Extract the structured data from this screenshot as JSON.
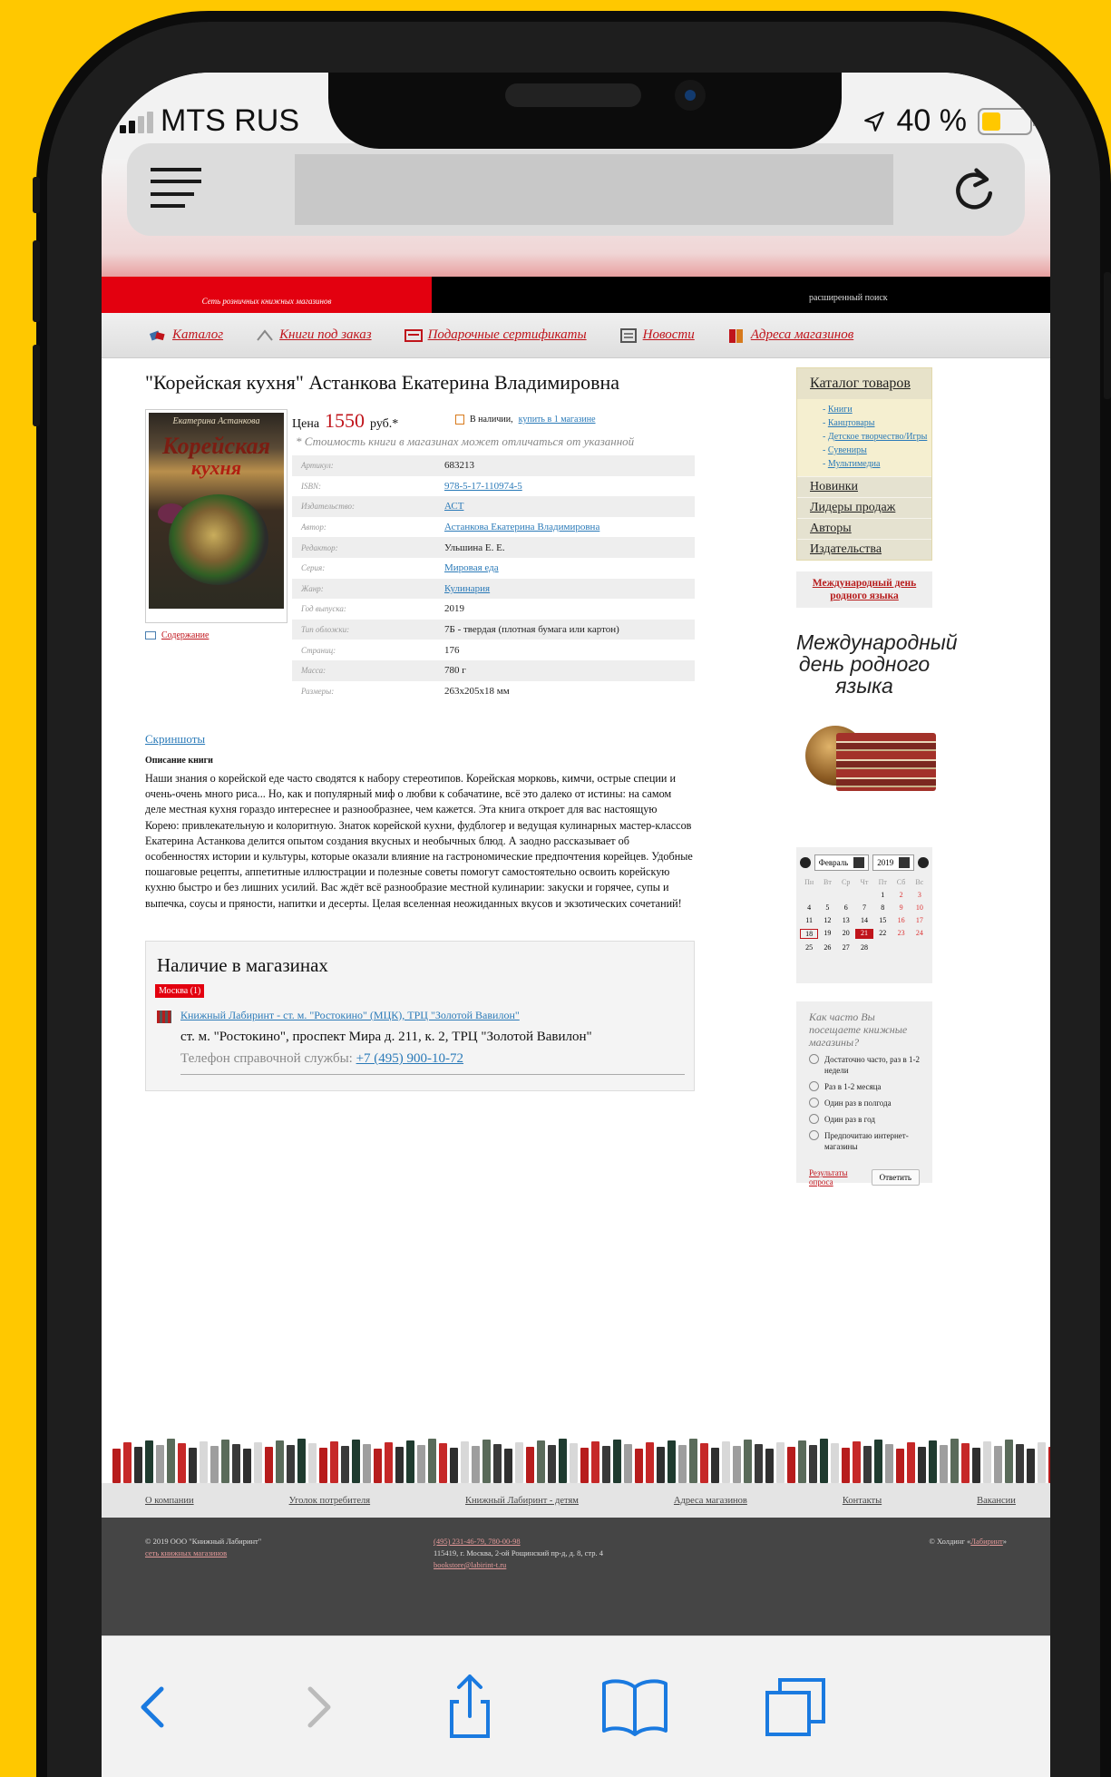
{
  "status": {
    "carrier": "MTS RUS",
    "battery": "40 %",
    "battery_level": 0.4
  },
  "header": {
    "tagline": "Сеть розничных книжных магазинов",
    "advanced_search": "расширенный поиск"
  },
  "nav": [
    {
      "label": "Каталог",
      "icon": "catalog-icon"
    },
    {
      "label": "Книги под заказ",
      "icon": "order-books-icon"
    },
    {
      "label": "Подарочные сертификаты",
      "icon": "gift-certificate-icon"
    },
    {
      "label": "Новости",
      "icon": "news-icon"
    },
    {
      "label": "Адреса магазинов",
      "icon": "store-addresses-icon"
    }
  ],
  "book": {
    "title": "\"Корейская кухня\" Астанкова Екатерина Владимировна",
    "cover_author": "Екатерина Астанкова",
    "cover_title_1": "Корейская",
    "cover_title_2": "кухня",
    "contents_link": "Содержание",
    "price_label": "Цена",
    "price_value": "1550",
    "price_unit": "руб.*",
    "stock_text": "В наличии,",
    "stock_link": "купить в 1 магазине",
    "price_note": "* Стоимость книги в магазинах может отличаться от указанной",
    "specs": [
      {
        "k": "Артикул:",
        "v": "683213",
        "link": false
      },
      {
        "k": "ISBN:",
        "v": "978-5-17-110974-5",
        "link": true
      },
      {
        "k": "Издательство:",
        "v": "АСТ",
        "link": true
      },
      {
        "k": "Автор:",
        "v": "Астанкова Екатерина Владимировна",
        "link": true
      },
      {
        "k": "Редактор:",
        "v": "Ульшина Е. Е.",
        "link": false
      },
      {
        "k": "Серия:",
        "v": "Мировая еда",
        "link": true
      },
      {
        "k": "Жанр:",
        "v": "Кулинария",
        "link": true
      },
      {
        "k": "Год выпуска:",
        "v": "2019",
        "link": false
      },
      {
        "k": "Тип обложки:",
        "v": "7Б - твердая (плотная бумага или картон)",
        "link": false
      },
      {
        "k": "Страниц:",
        "v": "176",
        "link": false
      },
      {
        "k": "Масса:",
        "v": "780 г",
        "link": false
      },
      {
        "k": "Размеры:",
        "v": "263x205x18 мм",
        "link": false
      }
    ],
    "screenshots_link": "Скриншоты",
    "description_heading": "Описание книги",
    "description": "Наши знания о корейской еде часто сводятся к набору стереотипов. Корейская морковь, кимчи, острые специи и очень-очень много риса... Но, как и популярный миф о любви к собачатине, всё это далеко от истины: на самом деле местная кухня гораздо интереснее и разнообразнее, чем кажется. Эта книга откроет для вас настоящую Корею: привлекательную и колоритную. Знаток корейской кухни, фудблогер и ведущая кулинарных мастер-классов Екатерина Астанкова делится опытом создания вкусных и необычных блюд. А заодно рассказывает об особенностях истории и культуры, которые оказали влияние на гастрономические предпочтения корейцев. Удобные пошаговые рецепты, аппетитные иллюстрации и полезные советы помогут самостоятельно освоить корейскую кухню быстро и без лишних усилий. Вас ждёт всё разнообразие местной кулинарии: закуски и горячее, супы и выпечка, соусы и пряности, напитки и десерты. Целая вселенная неожиданных вкусов и экзотических сочетаний!"
  },
  "availability": {
    "heading": "Наличие в магазинах",
    "city": "Москва (1)",
    "shop_link": "Книжный Лабиринт - ст. м. \"Ростокино\" (МЦК), ТРЦ \"Золотой Вавилон\"",
    "address": "ст. м. \"Ростокино\", проспект Мира д. 211, к. 2, ТРЦ \"Золотой Вавилон\"",
    "phone_label": "Телефон справочной службы:",
    "phone": "+7 (495) 900-10-72"
  },
  "sidebar": {
    "catalog_title": "Каталог товаров",
    "catalog_items": [
      "Книги",
      "Канцтовары",
      "Детское творчество/Игры",
      "Сувениры",
      "Мультимедиа"
    ],
    "links": [
      "Новинки",
      "Лидеры продаж",
      "Авторы",
      "Издательства"
    ],
    "promo_link": "Международный день родного языка",
    "promo_text": "Международный день родного языка"
  },
  "calendar": {
    "month": "Февраль",
    "year": "2019",
    "weekdays": [
      "Пн",
      "Вт",
      "Ср",
      "Чт",
      "Пт",
      "Сб",
      "Вс"
    ],
    "days": [
      "",
      "",
      "",
      "",
      "1",
      "2",
      "3",
      "4",
      "5",
      "6",
      "7",
      "8",
      "9",
      "10",
      "11",
      "12",
      "13",
      "14",
      "15",
      "16",
      "17",
      "18",
      "19",
      "20",
      "21",
      "22",
      "23",
      "24",
      "25",
      "26",
      "27",
      "28",
      "",
      "",
      ""
    ],
    "today": "21",
    "marked": "18"
  },
  "poll": {
    "question": "Как часто Вы посещаете книжные магазины?",
    "options": [
      "Достаточно часто, раз в 1-2 недели",
      "Раз в 1-2 месяца",
      "Один раз в полгода",
      "Один раз в год",
      "Предпочитаю интернет-магазины"
    ],
    "results": "Результаты опроса",
    "submit": "Ответить"
  },
  "footer_nav": [
    "О компании",
    "Уголок потребителя",
    "Книжный Лабиринт - детям",
    "Адреса магазинов",
    "Контакты",
    "Вакансии"
  ],
  "footer": {
    "copyright": "© 2019 ООО \"Книжный Лабиринт\"",
    "chain": "сеть книжных магазинов",
    "phones": "(495) 231-46-79, 780-00-98",
    "address": "115419, г. Москва, 2-ой Рощинский пр-д, д. 8, стр. 4",
    "email": "bookstore@labirint-t.ru",
    "holding": "© Холдинг «",
    "holding_link": "Лабиринт",
    "holding_end": "»"
  },
  "colors": {
    "brand_red": "#c0141b",
    "link_blue": "#2a7ab8",
    "ios_blue": "#1a7ae0",
    "frame_yellow": "#FFC800"
  }
}
